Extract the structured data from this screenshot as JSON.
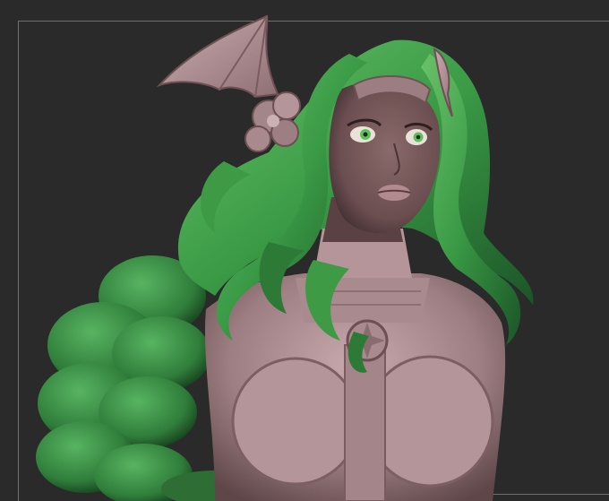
{
  "viewport": {
    "background_color": "#2a2a2a",
    "frame_color": "#6f6f6f"
  },
  "model": {
    "skin_color": "#a88b8f",
    "hair_color": "#3f9a45",
    "hair_shadow": "#1e5a2a",
    "eye_color": "#5fbf5a"
  }
}
